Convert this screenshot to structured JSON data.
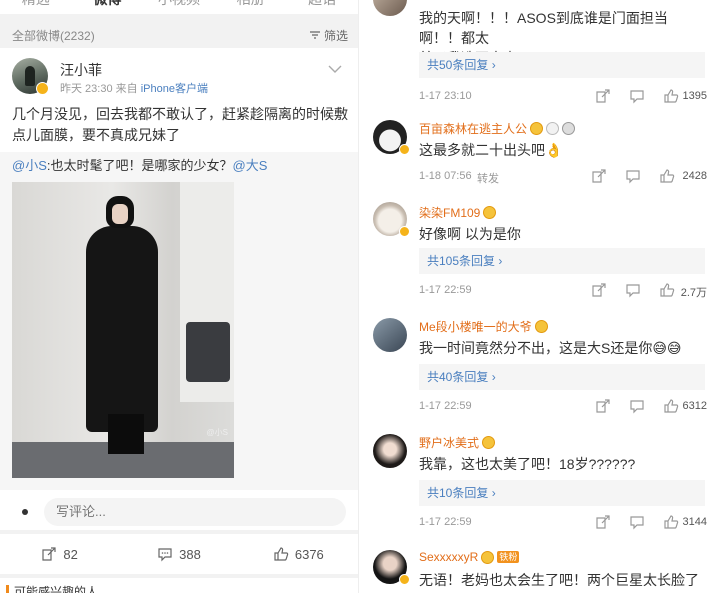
{
  "tabs": [
    "精选",
    "微博",
    "小视频",
    "相册",
    "超话"
  ],
  "feed": {
    "total_label": "全部微博(2232)",
    "filter_label": "筛选"
  },
  "post": {
    "author": "汪小菲",
    "time": "昨天 23:30",
    "source_prefix": "来自",
    "source": "iPhone客户端",
    "text": "几个月没见，回去我都不敢认了，赶紧趁隔离的时候敷点儿面膜，要不真成兄妹了",
    "repost_mention_1": "@小S",
    "repost_text": ":也太时髦了吧！是哪家的少女？",
    "repost_mention_2": "@大S",
    "photo_watermark": "@小S",
    "comment_placeholder": "写评论...",
    "reposts": "82",
    "comments": "388",
    "likes": "6376"
  },
  "bottom_hint": "可能感兴趣的人",
  "comments": [
    {
      "name": "",
      "text": "我的天啊！！！ASOS到底谁是门面担当啊！！都太美了我选不出来！！",
      "text_line1": "我的天啊！！！ASOS到底谁是门面担当啊！！都太",
      "text_line2": "美了我选不出来！！",
      "replies": "共50条回复",
      "time": "1-17 23:10",
      "forward": "",
      "likes": "1395"
    },
    {
      "name": "百亩森林在逃主人公",
      "text": "这最多就二十出头吧👌",
      "replies": "",
      "time": "1-18 07:56",
      "forward": "转发",
      "likes": "2428"
    },
    {
      "name": "染染FM109",
      "text": "好像啊 以为是你",
      "replies": "共105条回复",
      "time": "1-17 22:59",
      "forward": "",
      "likes": "2.7万"
    },
    {
      "name": "Me段小楼唯一的大爷",
      "text": "我一时间竟然分不出，这是大S还是你😅😅",
      "replies": "共40条回复",
      "time": "1-17 22:59",
      "forward": "",
      "likes": "6312"
    },
    {
      "name": "野户冰美式",
      "text": "我靠，这也太美了吧！18岁??????",
      "replies": "共10条回复",
      "time": "1-17 22:59",
      "forward": "",
      "likes": "3144"
    },
    {
      "name": "SexxxxxyR",
      "tag": "铁粉",
      "text": "无语！老妈也太会生了吧！两个巨星太长脸了",
      "replies": "",
      "time": "",
      "forward": "",
      "likes": ""
    }
  ],
  "reply_chevron": "›"
}
